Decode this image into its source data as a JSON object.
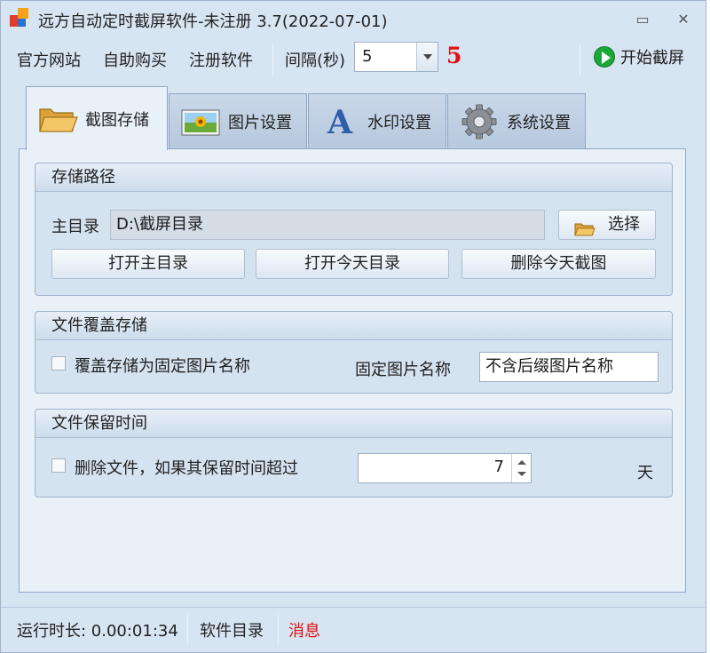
{
  "window": {
    "title": "远方自动定时截屏软件-未注册 3.7(2022-07-01)",
    "minimize_glyph": "▭",
    "close_glyph": "✕"
  },
  "toolbar": {
    "menu": [
      "官方网站",
      "自助购买",
      "注册软件"
    ],
    "interval_label": "间隔(秒)",
    "interval_value": "5",
    "countdown": "5",
    "start_label": "开始截屏"
  },
  "tabs": [
    {
      "label": "截图存储",
      "icon": "folder-icon",
      "active": true
    },
    {
      "label": "图片设置",
      "icon": "picture-icon",
      "active": false
    },
    {
      "label": "水印设置",
      "icon": "letter-a-icon",
      "active": false
    },
    {
      "label": "系统设置",
      "icon": "gear-icon",
      "active": false
    }
  ],
  "storage": {
    "title": "存储路径",
    "main_dir_label": "主目录",
    "main_dir_value": "D:\\截屏目录",
    "choose_label": "选择",
    "open_main": "打开主目录",
    "open_today": "打开今天目录",
    "delete_today": "删除今天截图"
  },
  "overwrite": {
    "title": "文件覆盖存储",
    "checkbox_label": "覆盖存储为固定图片名称",
    "checked": false,
    "fixed_name_label": "固定图片名称",
    "fixed_name_value": "不含后缀图片名称"
  },
  "retention": {
    "title": "文件保留时间",
    "checkbox_label": "删除文件，如果其保留时间超过",
    "checked": false,
    "days_value": "7",
    "unit": "天"
  },
  "status": {
    "runtime": "运行时长: 0.00:01:34",
    "software_dir": "软件目录",
    "message": "消息"
  },
  "colors": {
    "accent_red": "#e01010",
    "start_green": "#1aa838",
    "window_bg": "#d7e4f2"
  }
}
